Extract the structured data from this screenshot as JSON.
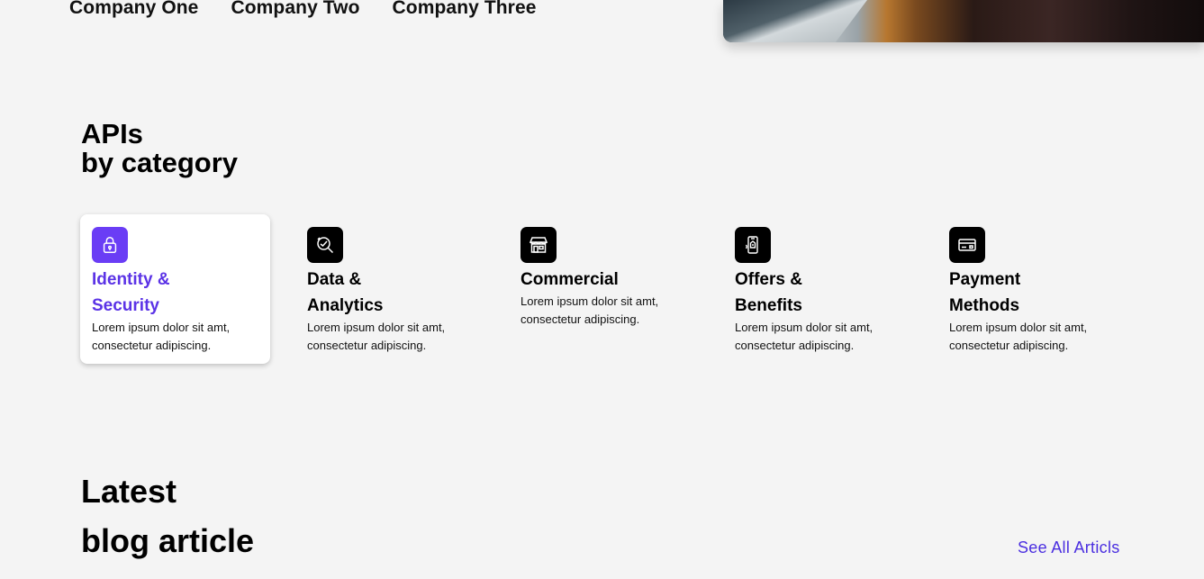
{
  "logos": [
    "Company One",
    "Company Two",
    "Company Three"
  ],
  "apis_section": {
    "title_line1": "APIs",
    "title_line2": "by category"
  },
  "categories": [
    {
      "name_line1": "Identity &",
      "name_line2": "Security",
      "description": "Lorem ipsum dolor sit amt, consectetur adipiscing.",
      "icon": "lock-icon",
      "active": true
    },
    {
      "name_line1": "Data &",
      "name_line2": "Analytics",
      "description": "Lorem ipsum dolor sit amt, consectetur adipiscing.",
      "icon": "search-chart-icon",
      "active": false
    },
    {
      "name_line1": "Commercial",
      "name_line2": "",
      "description": "Lorem ipsum dolor sit amt, consectetur adipiscing.",
      "icon": "storefront-icon",
      "active": false
    },
    {
      "name_line1": "Offers &",
      "name_line2": "Benefits",
      "description": "Lorem ipsum dolor sit amt, consectetur adipiscing.",
      "icon": "mobile-offer-icon",
      "active": false
    },
    {
      "name_line1": "Payment",
      "name_line2": "Methods",
      "description": "Lorem ipsum dolor sit amt, consectetur adipiscing.",
      "icon": "credit-card-icon",
      "active": false
    }
  ],
  "blog_section": {
    "title_line1": "Latest",
    "title_line2": "blog article",
    "see_all_label": "See All Articls"
  },
  "colors": {
    "accent": "#5b33e6",
    "accent_icon_bg": "#6a3df5",
    "page_bg": "#f4f4f4"
  }
}
